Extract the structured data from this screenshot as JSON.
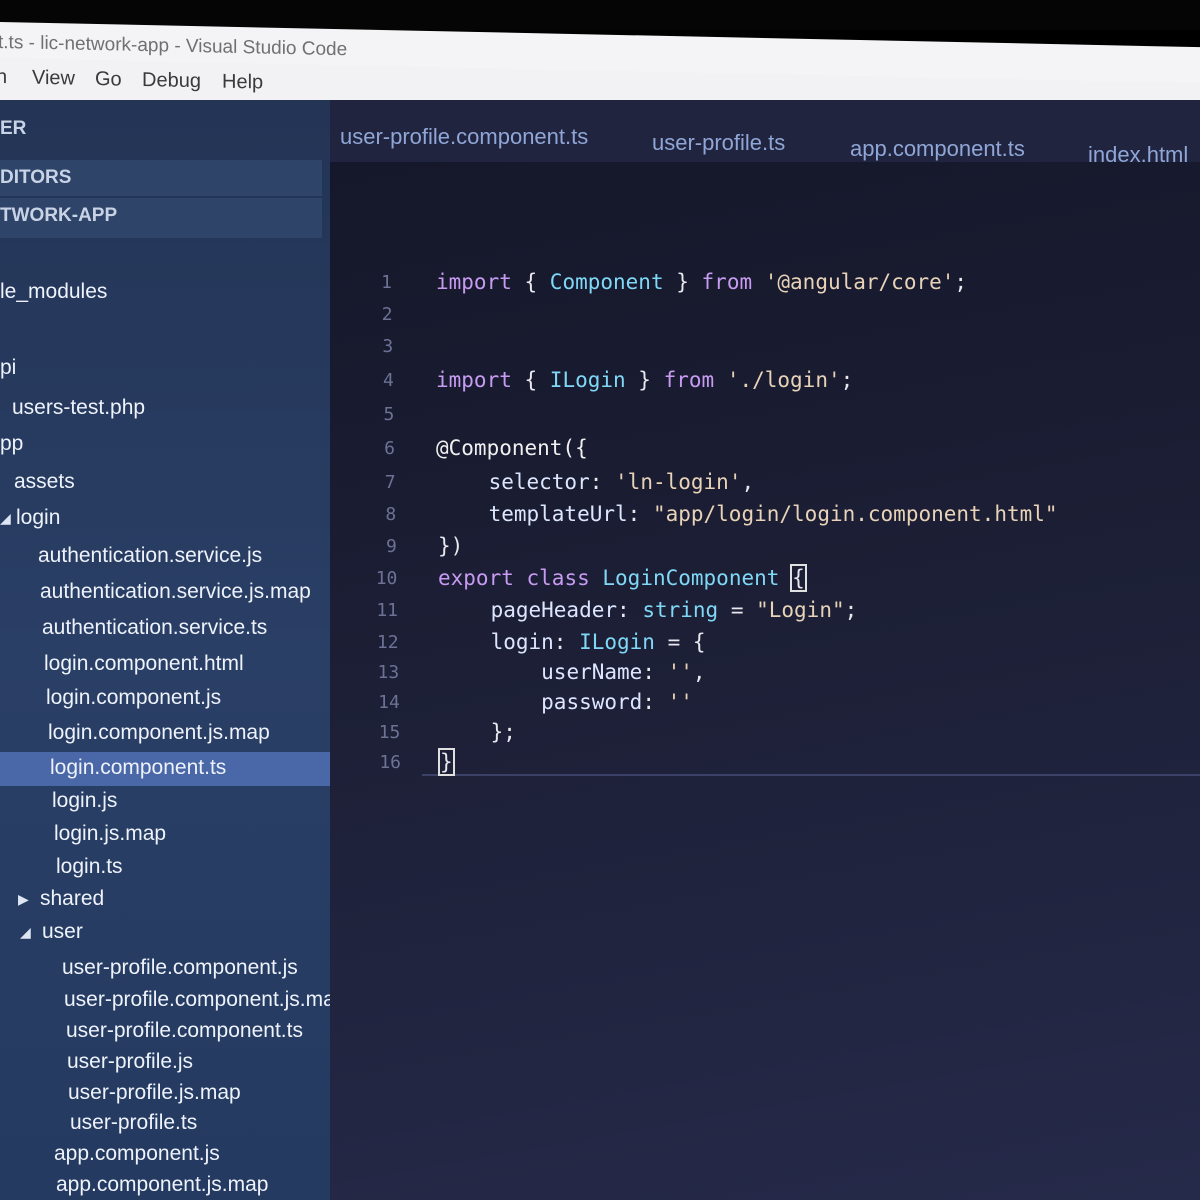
{
  "window": {
    "title": "t.ts - lic-network-app - Visual Studio Code"
  },
  "menu": [
    "n",
    "View",
    "Go",
    "Debug",
    "Help"
  ],
  "sidebar": {
    "explorer": "ER",
    "open_editors": "DITORS",
    "project": "TWORK-APP",
    "items": [
      {
        "label": "le_modules"
      },
      {
        "label": "pi"
      },
      {
        "label": "users-test.php"
      },
      {
        "label": "pp"
      },
      {
        "label": "assets"
      },
      {
        "label": "login"
      },
      {
        "label": "authentication.service.js"
      },
      {
        "label": "authentication.service.js.map"
      },
      {
        "label": "authentication.service.ts"
      },
      {
        "label": "login.component.html"
      },
      {
        "label": "login.component.js"
      },
      {
        "label": "login.component.js.map"
      },
      {
        "label": "login.component.ts"
      },
      {
        "label": "login.js"
      },
      {
        "label": "login.js.map"
      },
      {
        "label": "login.ts"
      },
      {
        "label": "shared"
      },
      {
        "label": "user"
      },
      {
        "label": "user-profile.component.js"
      },
      {
        "label": "user-profile.component.js.map"
      },
      {
        "label": "user-profile.component.ts"
      },
      {
        "label": "user-profile.js"
      },
      {
        "label": "user-profile.js.map"
      },
      {
        "label": "user-profile.ts"
      },
      {
        "label": "app.component.js"
      },
      {
        "label": "app.component.js.map"
      }
    ],
    "selected": "login.component.ts"
  },
  "tabs": [
    {
      "label": "user-profile.component.ts"
    },
    {
      "label": "user-profile.ts"
    },
    {
      "label": "app.component.ts"
    },
    {
      "label": "index.html"
    }
  ],
  "editor": {
    "line_numbers": [
      "1",
      "2",
      "3",
      "4",
      "5",
      "6",
      "7",
      "8",
      "9",
      "10",
      "11",
      "12",
      "13",
      "14",
      "15",
      "16"
    ],
    "lines": [
      [
        {
          "t": "import",
          "c": "kw"
        },
        {
          "t": " { ",
          "c": "pl"
        },
        {
          "t": "Component",
          "c": "ty"
        },
        {
          "t": " } ",
          "c": "pl"
        },
        {
          "t": "from",
          "c": "kw"
        },
        {
          "t": " '@angular/core'",
          "c": "st"
        },
        {
          "t": ";",
          "c": "pl"
        }
      ],
      [],
      [],
      [
        {
          "t": "import",
          "c": "kw"
        },
        {
          "t": " { ",
          "c": "pl"
        },
        {
          "t": "ILogin",
          "c": "ty"
        },
        {
          "t": " } ",
          "c": "pl"
        },
        {
          "t": "from",
          "c": "kw"
        },
        {
          "t": " './login'",
          "c": "st"
        },
        {
          "t": ";",
          "c": "pl"
        }
      ],
      [],
      [
        {
          "t": "@Component({",
          "c": "at"
        }
      ],
      [
        {
          "t": "    ",
          "c": "pl"
        },
        {
          "t": "selector",
          "c": "pr"
        },
        {
          "t": ": ",
          "c": "pl"
        },
        {
          "t": "'ln-login'",
          "c": "st"
        },
        {
          "t": ",",
          "c": "pl"
        }
      ],
      [
        {
          "t": "    ",
          "c": "pl"
        },
        {
          "t": "templateUrl",
          "c": "pr"
        },
        {
          "t": ": ",
          "c": "pl"
        },
        {
          "t": "\"app/login/login.component.html\"",
          "c": "st"
        }
      ],
      [
        {
          "t": "})",
          "c": "pl"
        }
      ],
      [
        {
          "t": "export",
          "c": "kw"
        },
        {
          "t": " ",
          "c": "pl"
        },
        {
          "t": "class",
          "c": "kw"
        },
        {
          "t": " ",
          "c": "pl"
        },
        {
          "t": "LoginComponent",
          "c": "ty"
        },
        {
          "t": " ",
          "c": "pl"
        },
        {
          "t": "{",
          "c": "cur"
        }
      ],
      [
        {
          "t": "    ",
          "c": "pl"
        },
        {
          "t": "pageHeader",
          "c": "pr"
        },
        {
          "t": ": ",
          "c": "pl"
        },
        {
          "t": "string",
          "c": "ty"
        },
        {
          "t": " = ",
          "c": "pl"
        },
        {
          "t": "\"Login\"",
          "c": "st"
        },
        {
          "t": ";",
          "c": "pl"
        }
      ],
      [
        {
          "t": "    ",
          "c": "pl"
        },
        {
          "t": "login",
          "c": "pr"
        },
        {
          "t": ": ",
          "c": "pl"
        },
        {
          "t": "ILogin",
          "c": "ty"
        },
        {
          "t": " = {",
          "c": "pl"
        }
      ],
      [
        {
          "t": "        ",
          "c": "pl"
        },
        {
          "t": "userName",
          "c": "pr"
        },
        {
          "t": ": ",
          "c": "pl"
        },
        {
          "t": "''",
          "c": "st"
        },
        {
          "t": ",",
          "c": "pl"
        }
      ],
      [
        {
          "t": "        ",
          "c": "pl"
        },
        {
          "t": "password",
          "c": "pr"
        },
        {
          "t": ": ",
          "c": "pl"
        },
        {
          "t": "''",
          "c": "st"
        }
      ],
      [
        {
          "t": "    };",
          "c": "pl"
        }
      ],
      [
        {
          "t": "}",
          "c": "cur"
        }
      ]
    ]
  },
  "colors": {
    "sidebar_bg": "#2a3f66",
    "selection": "#4a67a8",
    "editor_bg": "#1d2037",
    "keyword": "#c79bf2",
    "type": "#7fd8f6",
    "string": "#e8d3b8"
  }
}
